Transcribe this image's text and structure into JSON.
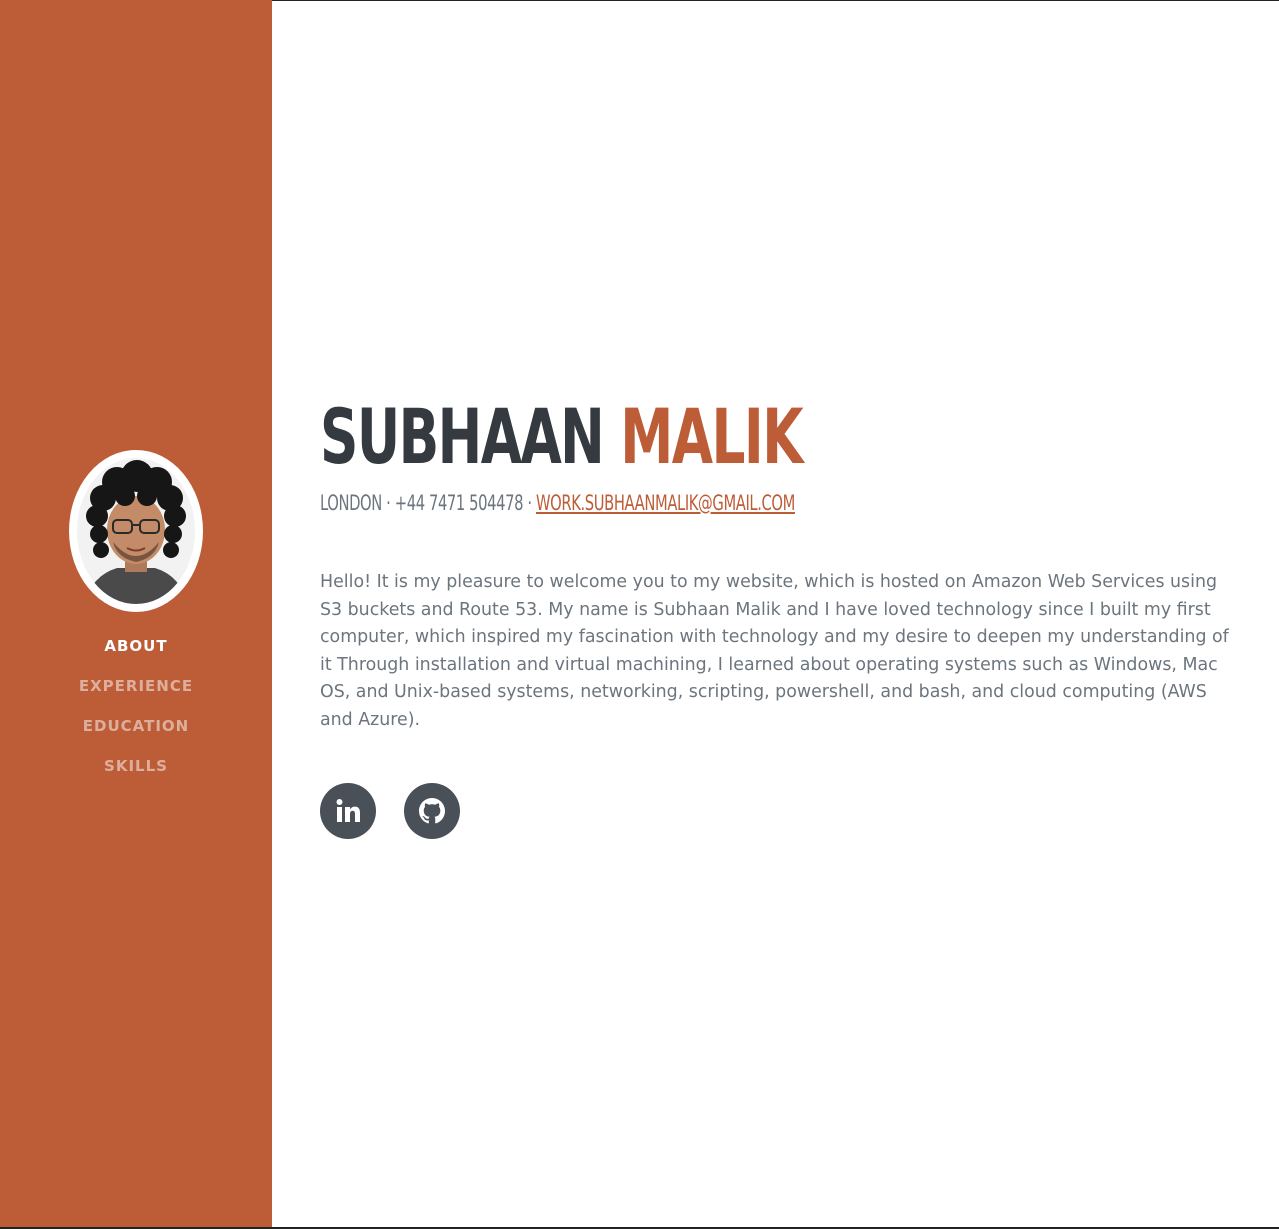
{
  "colors": {
    "accent": "#bd5d38",
    "heading": "#343a40",
    "text": "#6c757d",
    "social_bg": "#495057"
  },
  "sidebar": {
    "profile_image": "profile-photo",
    "nav": [
      {
        "label": "ABOUT",
        "active": true
      },
      {
        "label": "EXPERIENCE",
        "active": false
      },
      {
        "label": "EDUCATION",
        "active": false
      },
      {
        "label": "SKILLS",
        "active": false
      }
    ]
  },
  "about": {
    "first_name": "SUBHAAN",
    "last_name": "MALIK",
    "location": "LONDON",
    "separator": "·",
    "phone": "+44 7471 504478",
    "email": "WORK.SUBHAANMALIK@GMAIL.COM",
    "bio": "Hello! It is my pleasure to welcome you to my website, which is hosted on Amazon Web Services using S3 buckets and Route 53. My name is Subhaan Malik and I have loved technology since I built my first computer, which inspired my fascination with technology and my desire to deepen my understanding of it Through installation and virtual machining, I learned about operating systems such as Windows, Mac OS, and Unix-based systems, networking, scripting, powershell, and bash, and cloud computing (AWS and Azure).",
    "social": [
      {
        "icon": "linkedin-icon"
      },
      {
        "icon": "github-icon"
      }
    ]
  }
}
